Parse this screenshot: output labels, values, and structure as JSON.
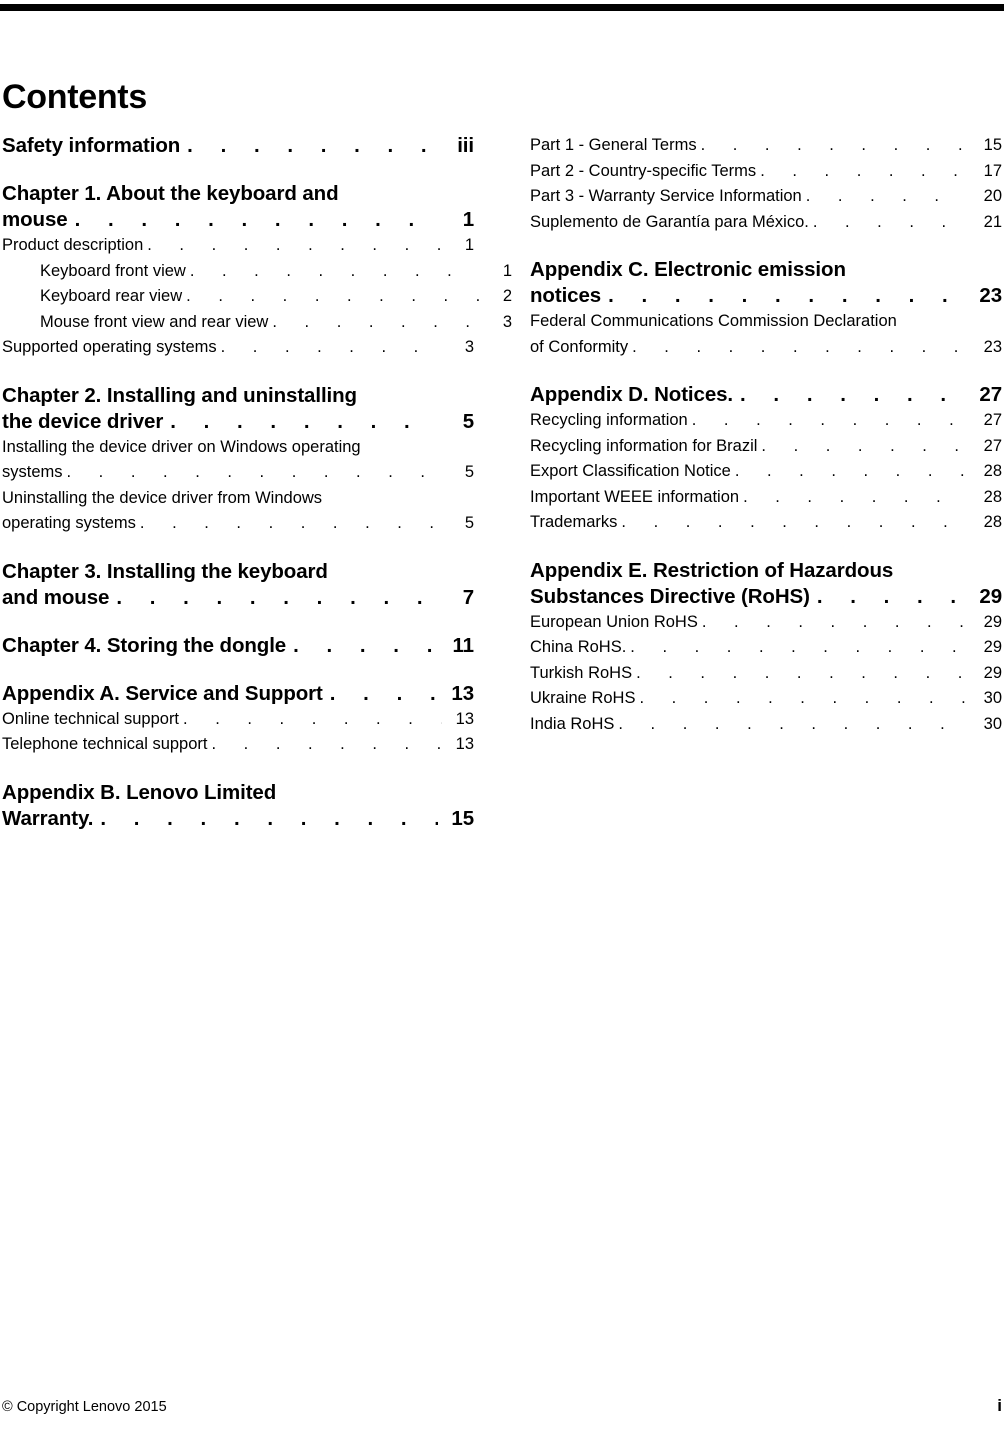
{
  "document": {
    "title": "Contents",
    "footer": {
      "copyright": "© Copyright Lenovo 2015",
      "page_number": "i"
    }
  },
  "toc": {
    "left_column": [
      {
        "type": "heading",
        "lines": [
          "Safety information"
        ],
        "page": "iii"
      },
      {
        "type": "heading",
        "lines": [
          "Chapter 1. About the keyboard and",
          "mouse"
        ],
        "page": "1"
      },
      {
        "type": "section",
        "indent": 0,
        "lines": [
          "Product description"
        ],
        "page": "1"
      },
      {
        "type": "section",
        "indent": 1,
        "lines": [
          "Keyboard front view"
        ],
        "page": "1"
      },
      {
        "type": "section",
        "indent": 1,
        "lines": [
          "Keyboard rear view"
        ],
        "page": "2"
      },
      {
        "type": "section",
        "indent": 1,
        "lines": [
          "Mouse front view and rear view"
        ],
        "page": "3"
      },
      {
        "type": "section",
        "indent": 0,
        "lines": [
          "Supported operating systems"
        ],
        "page": "3"
      },
      {
        "type": "heading",
        "lines": [
          "Chapter 2. Installing and uninstalling",
          "the device driver"
        ],
        "page": "5"
      },
      {
        "type": "section",
        "indent": 0,
        "lines": [
          "Installing the device driver on Windows operating",
          "systems"
        ],
        "page": "5"
      },
      {
        "type": "section",
        "indent": 0,
        "lines": [
          "Uninstalling the device driver from Windows",
          "operating systems"
        ],
        "page": "5"
      },
      {
        "type": "heading",
        "lines": [
          "Chapter 3. Installing the keyboard",
          "and mouse"
        ],
        "page": "7"
      },
      {
        "type": "heading",
        "lines": [
          "Chapter 4. Storing the dongle"
        ],
        "page": "11"
      },
      {
        "type": "heading",
        "lines": [
          "Appendix A. Service and Support"
        ],
        "page": "13"
      },
      {
        "type": "section",
        "indent": 0,
        "lines": [
          "Online technical support"
        ],
        "page": "13"
      },
      {
        "type": "section",
        "indent": 0,
        "lines": [
          "Telephone technical support"
        ],
        "page": "13"
      },
      {
        "type": "heading",
        "lines": [
          "Appendix B. Lenovo  Limited",
          "Warranty."
        ],
        "page": "15"
      }
    ],
    "right_column": [
      {
        "type": "section",
        "indent": 0,
        "lines": [
          "Part 1 - General Terms"
        ],
        "page": "15"
      },
      {
        "type": "section",
        "indent": 0,
        "lines": [
          "Part 2 - Country-specific Terms"
        ],
        "page": "17"
      },
      {
        "type": "section",
        "indent": 0,
        "lines": [
          "Part 3 - Warranty Service Information"
        ],
        "page": "20"
      },
      {
        "type": "section",
        "indent": 0,
        "lines": [
          "Suplemento de Garantía para México."
        ],
        "page": "21"
      },
      {
        "type": "heading",
        "lines": [
          "Appendix C. Electronic emission",
          "notices"
        ],
        "page": "23"
      },
      {
        "type": "section",
        "indent": 0,
        "lines": [
          "Federal Communications Commission Declaration",
          "of Conformity"
        ],
        "page": "23"
      },
      {
        "type": "heading",
        "lines": [
          "Appendix D. Notices."
        ],
        "page": "27"
      },
      {
        "type": "section",
        "indent": 0,
        "lines": [
          "Recycling information"
        ],
        "page": "27"
      },
      {
        "type": "section",
        "indent": 0,
        "lines": [
          "Recycling information for Brazil"
        ],
        "page": "27"
      },
      {
        "type": "section",
        "indent": 0,
        "lines": [
          "Export Classification Notice"
        ],
        "page": "28"
      },
      {
        "type": "section",
        "indent": 0,
        "lines": [
          "Important WEEE information"
        ],
        "page": "28"
      },
      {
        "type": "section",
        "indent": 0,
        "lines": [
          "Trademarks"
        ],
        "page": "28"
      },
      {
        "type": "heading",
        "lines": [
          "Appendix E. Restriction of Hazardous",
          "Substances Directive (RoHS)"
        ],
        "page": "29"
      },
      {
        "type": "section",
        "indent": 0,
        "lines": [
          "European Union RoHS"
        ],
        "page": "29"
      },
      {
        "type": "section",
        "indent": 0,
        "lines": [
          "China RoHS."
        ],
        "page": "29"
      },
      {
        "type": "section",
        "indent": 0,
        "lines": [
          "Turkish RoHS"
        ],
        "page": "29"
      },
      {
        "type": "section",
        "indent": 0,
        "lines": [
          "Ukraine RoHS"
        ],
        "page": "30"
      },
      {
        "type": "section",
        "indent": 0,
        "lines": [
          "India RoHS"
        ],
        "page": "30"
      }
    ]
  }
}
